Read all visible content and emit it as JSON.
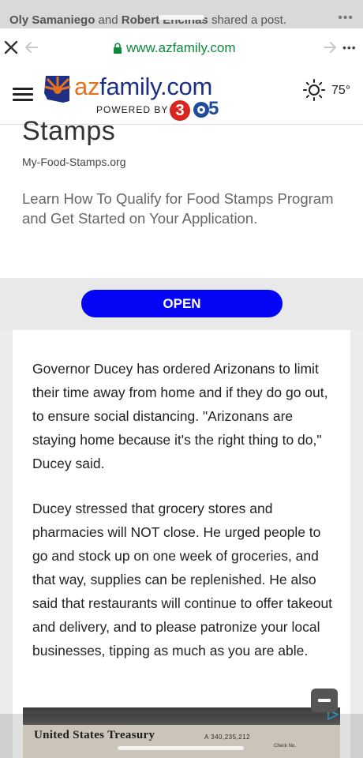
{
  "share": {
    "name1": "Oly Samaniego",
    "and": "and",
    "name2": "Robert Encinas",
    "action": "shared a post.",
    "more": "•••"
  },
  "browser": {
    "url": "www.azfamily.com",
    "more": "•••"
  },
  "site": {
    "logo_prefix": "az",
    "logo_rest": "family.com",
    "powered_by": "POWERED BY",
    "channel_3": "3",
    "channel_5": "5",
    "temperature": "75°",
    "weather_icon": "sun-icon"
  },
  "ad": {
    "title": "Stamps",
    "domain": "My-Food-Stamps.org",
    "body": "Learn How To Qualify for Food Stamps Program and Get Started on Your Application.",
    "cta": "OPEN",
    "cta_color": "#0505f5"
  },
  "article": {
    "paragraphs": [
      "Governor Ducey has ordered Arizonans to limit their time away from home and if they do go out, to ensure social distancing. \"Arizonans are staying home because it's the right thing to do,\" Ducey said.",
      "Ducey stressed that grocery stores and pharmacies will NOT close. He urged people to go and stock up on one week of groceries, and that way, supplies can be replenished. He also said that restaurants will continue to offer takeout and delivery, and to please patronize your local businesses, tipping as much as you are able."
    ]
  },
  "bottom_ad": {
    "check_title": "United States Treasury",
    "check_number": "A 340,235,212",
    "check_label": "Check No."
  },
  "colors": {
    "logo_orange": "#e4711e",
    "logo_blue": "#1f2f86",
    "url_green": "#0a8a3a"
  }
}
